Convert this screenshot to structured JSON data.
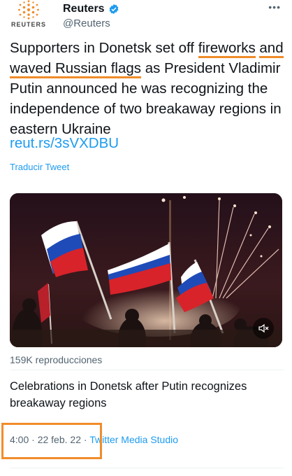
{
  "author": {
    "display_name": "Reuters",
    "handle": "@Reuters",
    "logo_text": "REUTERS",
    "verified_icon": "verified-badge-icon"
  },
  "tweet": {
    "text_before": "Supporters in Donetsk set off ",
    "text_highlight_1": "fireworks",
    "text_space": " ",
    "text_highlight_2": "and waved Russian flags",
    "text_after": " as President Vladimir Putin announced he was recognizing the independence of two breakaway regions in eastern Ukraine",
    "link": "reut.rs/3sVXDBU",
    "translate_label": "Traducir Tweet"
  },
  "media": {
    "views": "159K reproducciones",
    "title": "Celebrations in Donetsk after Putin recognizes breakaway regions",
    "mute_icon": "mute-icon"
  },
  "meta": {
    "time": "4:00",
    "separator": " · ",
    "date": "22 feb. 22",
    "source_sep": " · ",
    "source": "Twitter Media Studio"
  },
  "colors": {
    "accent": "#1d9bf0",
    "highlight": "#f08c2a",
    "text": "#0f1419",
    "muted": "#536471"
  }
}
